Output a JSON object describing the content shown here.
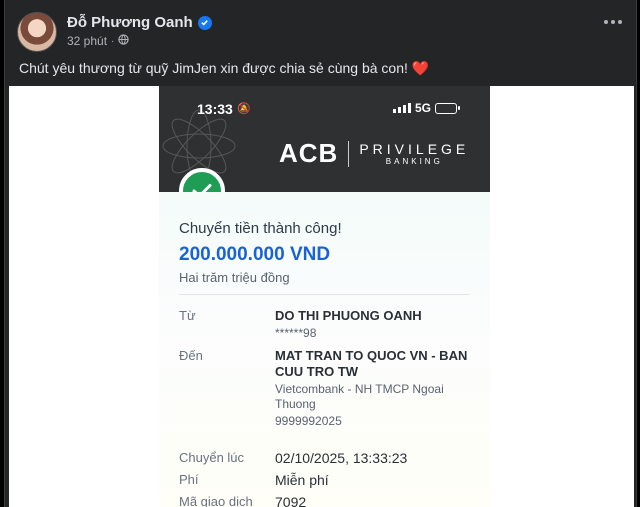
{
  "post": {
    "author": "Đỗ Phương Oanh",
    "time": "32 phút",
    "caption": "Chút yêu thương từ quỹ JimJen xin được chia sẻ cùng bà con!",
    "caption_emoji": "❤️"
  },
  "receipt": {
    "status_time": "13:33",
    "network": "5G",
    "brand": "ACB",
    "brand_line1": "PRIVILEGE",
    "brand_line2": "BANKING",
    "success_text": "Chuyển tiền thành công!",
    "amount": "200.000.000 VND",
    "amount_words": "Hai trăm triệu đồng",
    "from_label": "Từ",
    "from_name": "DO THI PHUONG OANH",
    "from_account": "******98",
    "to_label": "Đến",
    "to_name": "MAT TRAN TO QUOC VN - BAN CUU TRO TW",
    "to_bank": "Vietcombank - NH TMCP Ngoai Thuong",
    "to_account": "9999992025",
    "time_label": "Chuyển lúc",
    "time_value": "02/10/2025, 13:33:23",
    "fee_label": "Phí",
    "fee_value": "Miễn phí",
    "txn_label": "Mã giao dịch",
    "txn_value": "7092"
  },
  "colors": {
    "facebook_bg": "#242526",
    "verified": "#1877f2",
    "success_green": "#1f9d55",
    "amount_blue": "#1a63d6"
  }
}
